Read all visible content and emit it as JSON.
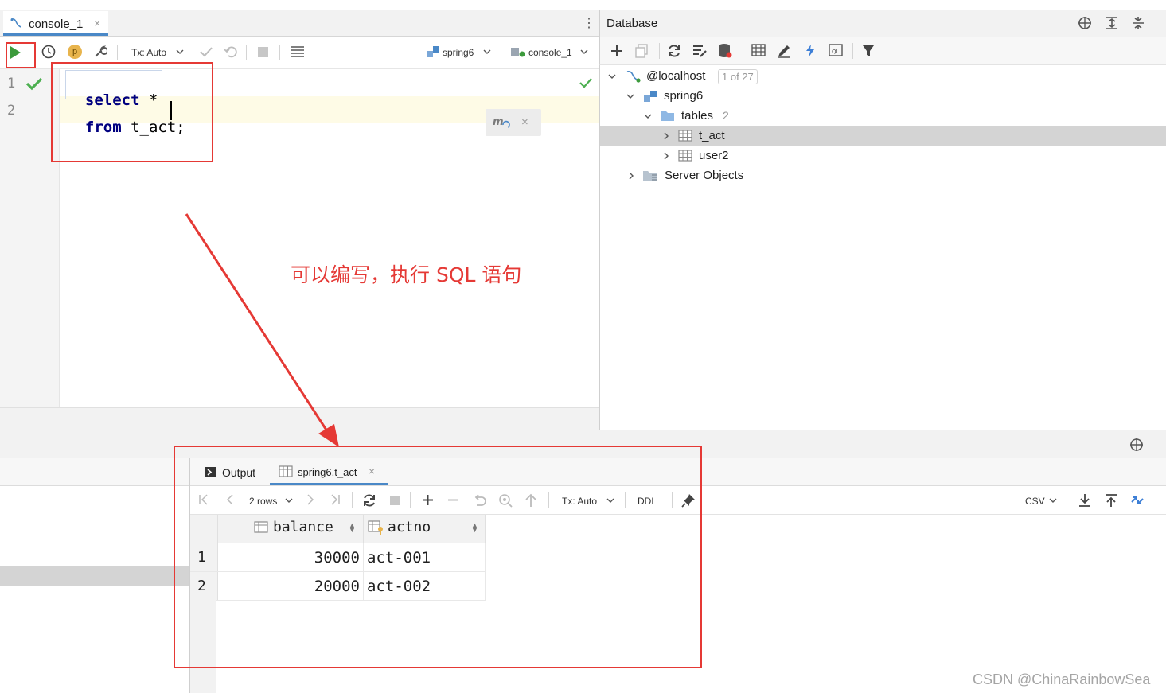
{
  "editor": {
    "tab_label": "console_1",
    "toolbar": {
      "tx_mode": "Tx: Auto",
      "schema_label": "spring6",
      "session_label": "console_1"
    },
    "lines": [
      {
        "number": "1",
        "keyword": "select",
        "rest": " *"
      },
      {
        "number": "2",
        "keyword": "from",
        "rest": " t_act;"
      }
    ]
  },
  "database": {
    "title": "Database",
    "tree": {
      "host": "@localhost",
      "host_badge": "1 of 27",
      "schema": "spring6",
      "tables_label": "tables",
      "tables_count": "2",
      "table_1": "t_act",
      "table_2": "user2",
      "server_objects": "Server Objects"
    }
  },
  "annotation": {
    "text": "可以编写，执行 SQL 语句",
    "color": "#e53935"
  },
  "results": {
    "tab_output": "Output",
    "tab_table": "spring6.t_act",
    "rows_label": "2 rows",
    "tx_mode": "Tx: Auto",
    "ddl_label": "DDL",
    "export_label": "CSV",
    "columns": [
      "balance",
      "actno"
    ],
    "rows": [
      {
        "num": "1",
        "balance": "30000",
        "actno": "act-001"
      },
      {
        "num": "2",
        "balance": "20000",
        "actno": "act-002"
      }
    ]
  },
  "watermark": "CSDN @ChinaRainbowSea",
  "colors": {
    "accent_red": "#e53935",
    "run_green": "#3c9a3c",
    "keyword_blue": "#000080",
    "selection": "#d4d4d4"
  }
}
